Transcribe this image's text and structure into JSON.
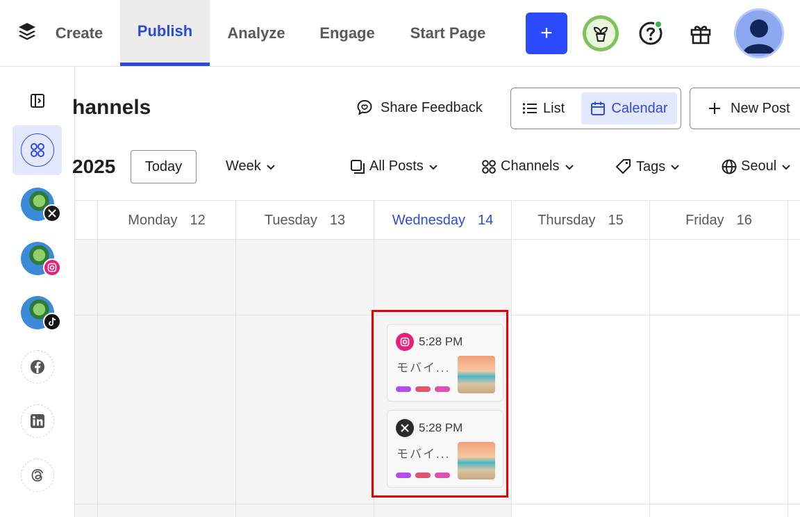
{
  "topnav": {
    "tabs": [
      {
        "label": "Create"
      },
      {
        "label": "Publish"
      },
      {
        "label": "Analyze"
      },
      {
        "label": "Engage"
      },
      {
        "label": "Start Page"
      }
    ],
    "plus_label": "+"
  },
  "sidebar": {
    "channels": [
      {
        "network": "x",
        "icon": "x-icon",
        "color": "#1a1a1a"
      },
      {
        "network": "instagram",
        "icon": "instagram-icon",
        "color": "#e4207b"
      },
      {
        "network": "tiktok",
        "icon": "tiktok-icon",
        "color": "#111111"
      },
      {
        "network": "facebook",
        "icon": "facebook-icon"
      },
      {
        "network": "linkedin",
        "icon": "linkedin-icon"
      },
      {
        "network": "threads",
        "icon": "threads-icon"
      }
    ]
  },
  "header": {
    "title": "Channels",
    "title_visible": "hannels",
    "share_feedback": "Share Feedback",
    "view_list": "List",
    "view_calendar": "Calendar",
    "new_post": "New Post"
  },
  "toolbar": {
    "year": "2025",
    "today": "Today",
    "range": "Week",
    "all_posts": "All Posts",
    "channels": "Channels",
    "tags": "Tags",
    "timezone": "Seoul"
  },
  "calendar": {
    "days": [
      {
        "name": "Monday",
        "num": "12"
      },
      {
        "name": "Tuesday",
        "num": "13"
      },
      {
        "name": "Wednesday",
        "num": "14"
      },
      {
        "name": "Thursday",
        "num": "15"
      },
      {
        "name": "Friday",
        "num": "16"
      }
    ],
    "posts": [
      {
        "network": "instagram",
        "time": "5:28 PM",
        "text": "モバイ..."
      },
      {
        "network": "x",
        "time": "5:28 PM",
        "text": "モバイ..."
      }
    ],
    "tag_colors": [
      "#b34fe8",
      "#e0566e",
      "#e04fb0"
    ]
  },
  "colors": {
    "accent": "#2c4bd9",
    "primary_button": "#2c4bff",
    "highlight": "#e60000"
  }
}
